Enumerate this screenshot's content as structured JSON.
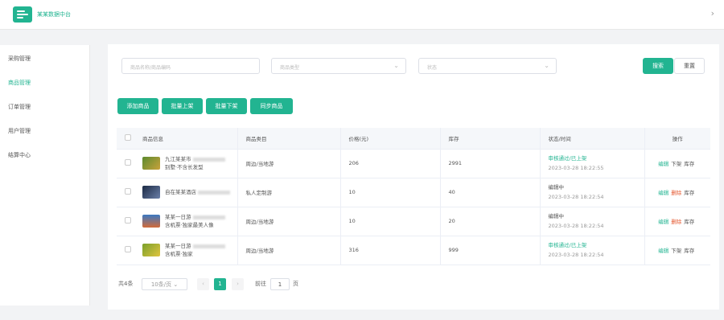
{
  "header": {
    "app_title": "某某数据中台"
  },
  "sidebar": {
    "items": [
      {
        "label": "采购管理"
      },
      {
        "label": "商品管理"
      },
      {
        "label": "订单管理"
      },
      {
        "label": "用户管理"
      },
      {
        "label": "结算中心"
      }
    ]
  },
  "filters": {
    "keyword_placeholder": "商品名称/商品编码",
    "category_placeholder": "商品类型",
    "status_placeholder": "状态",
    "search_label": "搜索",
    "reset_label": "重置"
  },
  "actions": {
    "add": "添加商品",
    "batch_up": "批量上架",
    "batch_down": "批量下架",
    "sync": "同步商品"
  },
  "table": {
    "columns": [
      "商品信息",
      "商品类目",
      "价格(元)",
      "库存",
      "状态/时间",
      "操作"
    ],
    "rows": [
      {
        "name": "九江某某市",
        "desc": "别墅·不含长发型",
        "category": "周边/当地游",
        "price": "206",
        "stock": "2991",
        "status": "审核通过/已上架",
        "time": "2023-03-28 18:22:55",
        "ops": [
          "编辑",
          "下架",
          "库存"
        ]
      },
      {
        "name": "自在某某酒店",
        "desc": "",
        "category": "私人定制游",
        "price": "10",
        "stock": "40",
        "status": "编辑中",
        "time": "2023-03-28 18:22:54",
        "ops": [
          "编辑",
          "删除",
          "库存"
        ]
      },
      {
        "name": "某某一日游",
        "desc": "含机票·独家最美人像",
        "category": "周边/当地游",
        "price": "10",
        "stock": "20",
        "status": "编辑中",
        "time": "2023-03-28 18:22:54",
        "ops": [
          "编辑",
          "删除",
          "库存"
        ]
      },
      {
        "name": "某某一日游",
        "desc": "含机票·独家",
        "category": "周边/当地游",
        "price": "316",
        "stock": "999",
        "status": "审核通过/已上架",
        "time": "2023-03-28 18:22:54",
        "ops": [
          "编辑",
          "下架",
          "库存"
        ]
      }
    ]
  },
  "pagination": {
    "total": "共4条",
    "page_size": "10条/页",
    "prev": "‹",
    "current": "1",
    "next": "›",
    "goto": "前往",
    "goto_value": "1",
    "page_unit": "页"
  }
}
